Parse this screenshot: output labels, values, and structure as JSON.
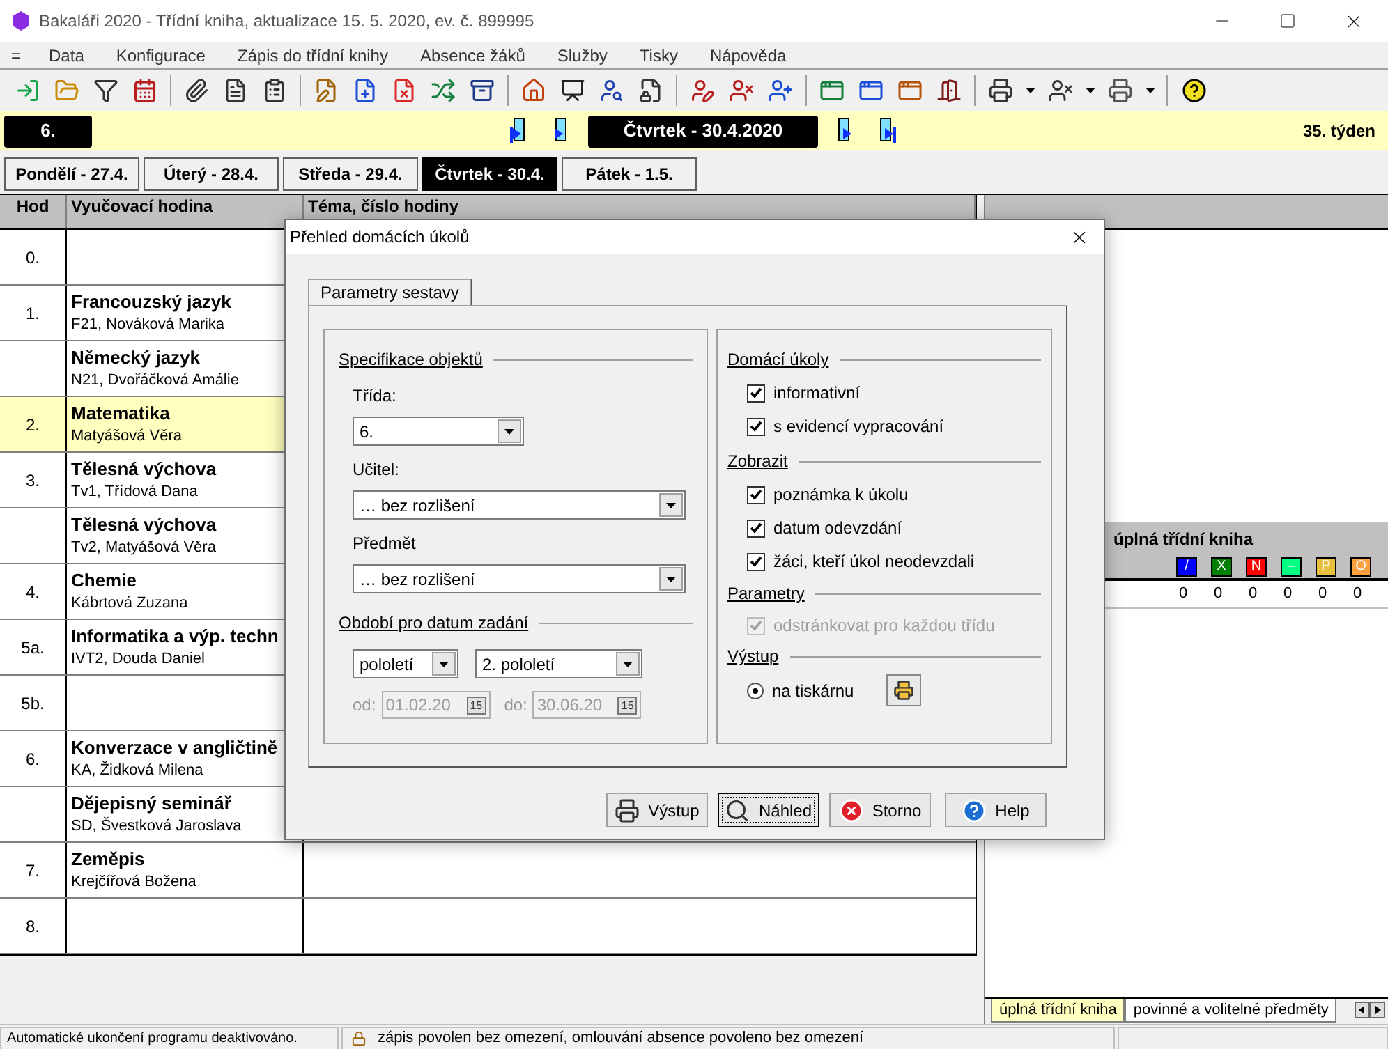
{
  "window": {
    "title": "Bakaláři 2020 - Třídní kniha, aktualizace 15. 5. 2020, ev. č. 899995"
  },
  "menu": [
    "=",
    "Data",
    "Konfigurace",
    "Zápis do třídní knihy",
    "Absence žáků",
    "Služby",
    "Tisky",
    "Nápověda"
  ],
  "nav": {
    "class": "6.",
    "date": "Čtvrtek - 30.4.2020",
    "week": "35. týden"
  },
  "day_tabs": [
    {
      "label": "Pondělí - 27.4.",
      "selected": false
    },
    {
      "label": "Úterý - 28.4.",
      "selected": false
    },
    {
      "label": "Středa - 29.4.",
      "selected": false
    },
    {
      "label": "Čtvrtek - 30.4.",
      "selected": true
    },
    {
      "label": "Pátek - 1.5.",
      "selected": false
    }
  ],
  "table": {
    "columns": [
      "Hod",
      "Vyučovací hodina",
      "Téma, číslo hodiny"
    ],
    "rows": [
      {
        "hour": "0.",
        "selected": false
      },
      {
        "hour": "1.",
        "subject": "Francouzský jazyk",
        "teacher": "F21, Nováková Marika",
        "selected": false
      },
      {
        "subject": "Německý jazyk",
        "teacher": "N21, Dvořáčková Amálie",
        "selected": false
      },
      {
        "hour": "2.",
        "subject": "Matematika",
        "teacher": "Matyášová Věra",
        "selected": true
      },
      {
        "hour": "3.",
        "subject": "Tělesná výchova",
        "teacher": "Tv1, Třídová Dana",
        "selected": false
      },
      {
        "subject": "Tělesná výchova",
        "teacher": "Tv2, Matyášová Věra",
        "selected": false
      },
      {
        "hour": "4.",
        "subject": "Chemie",
        "teacher": "Kábrtová Zuzana",
        "selected": false
      },
      {
        "hour": "5a.",
        "subject": "Informatika a výp. techn",
        "teacher": "IVT2, Douda Daniel",
        "selected": false
      },
      {
        "hour": "5b.",
        "selected": false
      },
      {
        "hour": "6.",
        "subject": "Konverzace v angličtině",
        "teacher": "KA, Židková Milena",
        "selected": false
      },
      {
        "subject": "Dějepisný seminář",
        "teacher": "SD, Švestková Jaroslava",
        "selected": false
      },
      {
        "hour": "7.",
        "subject": "Zeměpis",
        "teacher": "Krejčířová Božena",
        "selected": false
      },
      {
        "hour": "8.",
        "selected": false
      }
    ]
  },
  "right_panel": {
    "section_title": "úplná třídní kniha",
    "legend": [
      {
        "symbol": "/",
        "color": "#0000ff"
      },
      {
        "symbol": "X",
        "color": "#008000"
      },
      {
        "symbol": "N",
        "color": "#ff0000"
      },
      {
        "symbol": "–",
        "color": "#00ff80"
      },
      {
        "symbol": "P",
        "color": "#e8c040"
      },
      {
        "symbol": "O",
        "color": "#ffa040"
      }
    ],
    "counts": [
      "0",
      "0",
      "0",
      "0",
      "0",
      "0"
    ],
    "tabs": [
      {
        "label": "úplná třídní kniha",
        "selected": true
      },
      {
        "label": "povinné a volitelné předměty",
        "selected": false
      }
    ]
  },
  "dialog": {
    "title": "Přehled domácích úkolů",
    "tabs": [
      {
        "label": "Parametry sestavy",
        "selected": true
      }
    ],
    "objects": {
      "heading": "Specifikace objektů",
      "fields": [
        {
          "label": "Třída:",
          "value": "6."
        },
        {
          "label": "Učitel:",
          "value": "… bez rozlišení"
        },
        {
          "label": "Předmět",
          "value": "… bez rozlišení"
        }
      ]
    },
    "period": {
      "heading": "Období pro datum zadání",
      "type": "pololetí",
      "term": "2. pololetí",
      "from": {
        "label": "od:",
        "value": "01.02.20",
        "calendar": "15",
        "disabled": true
      },
      "to": {
        "label": "do:",
        "value": "30.06.20",
        "calendar": "15",
        "disabled": true
      }
    },
    "homework": {
      "heading": "Domácí úkoly",
      "options": [
        {
          "label": "informativní",
          "checked": true,
          "disabled": false
        },
        {
          "label": "s evidencí vypracování",
          "checked": true,
          "disabled": false
        }
      ]
    },
    "display": {
      "heading": "Zobrazit",
      "options": [
        {
          "label": "poznámka k úkolu",
          "checked": true,
          "disabled": false
        },
        {
          "label": "datum odevzdání",
          "checked": true,
          "disabled": false
        },
        {
          "label": "žáci, kteří úkol neodevzdali",
          "checked": true,
          "disabled": false
        }
      ]
    },
    "parameters": {
      "heading": "Parametry",
      "options": [
        {
          "label": "odstránkovat pro každou třídu",
          "checked": true,
          "disabled": true
        }
      ]
    },
    "output": {
      "heading": "Výstup",
      "options": [
        {
          "label": "na tiskárnu",
          "selected": true
        }
      ]
    },
    "buttons": [
      {
        "label": "Výstup",
        "kind": "print",
        "focused": false
      },
      {
        "label": "Náhled",
        "kind": "preview",
        "focused": true
      },
      {
        "label": "Storno",
        "kind": "cancel",
        "focused": false
      },
      {
        "label": "Help",
        "kind": "help",
        "focused": false
      }
    ]
  },
  "status_bar": [
    "Automatické ukončení programu deaktivováno.",
    "zápis povolen bez omezení, omlouvání absence povoleno bez omezení"
  ]
}
